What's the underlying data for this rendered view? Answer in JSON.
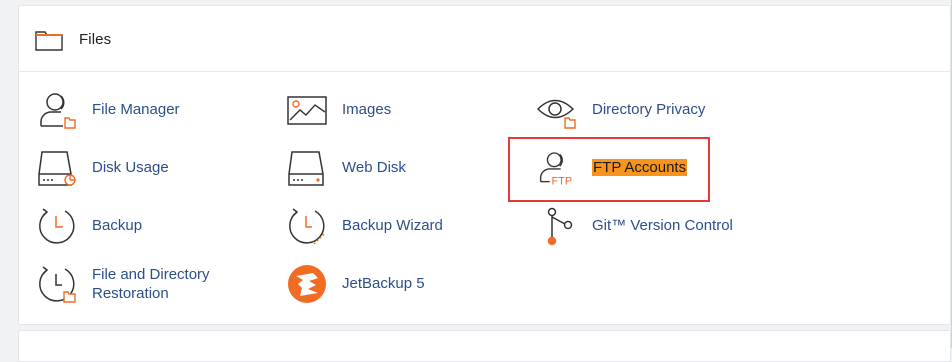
{
  "section": {
    "title": "Files",
    "icon": "folder-icon"
  },
  "items": [
    {
      "label": "File Manager",
      "icon": "file-manager-icon"
    },
    {
      "label": "Images",
      "icon": "images-icon"
    },
    {
      "label": "Directory Privacy",
      "icon": "directory-privacy-icon"
    },
    {
      "label": "Disk Usage",
      "icon": "disk-usage-icon"
    },
    {
      "label": "Web Disk",
      "icon": "web-disk-icon"
    },
    {
      "label": "FTP Accounts",
      "icon": "ftp-accounts-icon",
      "icon_text": "FTP"
    },
    {
      "label": "Backup",
      "icon": "backup-icon"
    },
    {
      "label": "Backup Wizard",
      "icon": "backup-wizard-icon"
    },
    {
      "label": "Git™ Version Control",
      "icon": "git-version-control-icon"
    },
    {
      "label": "File and Directory Restoration",
      "icon": "restoration-icon"
    },
    {
      "label": "JetBackup 5",
      "icon": "jetbackup-icon"
    }
  ],
  "colors": {
    "accent": "#f26b22",
    "link": "#2d4e8a",
    "highlight": "#f7941d",
    "annotation_box": "#e53935"
  }
}
